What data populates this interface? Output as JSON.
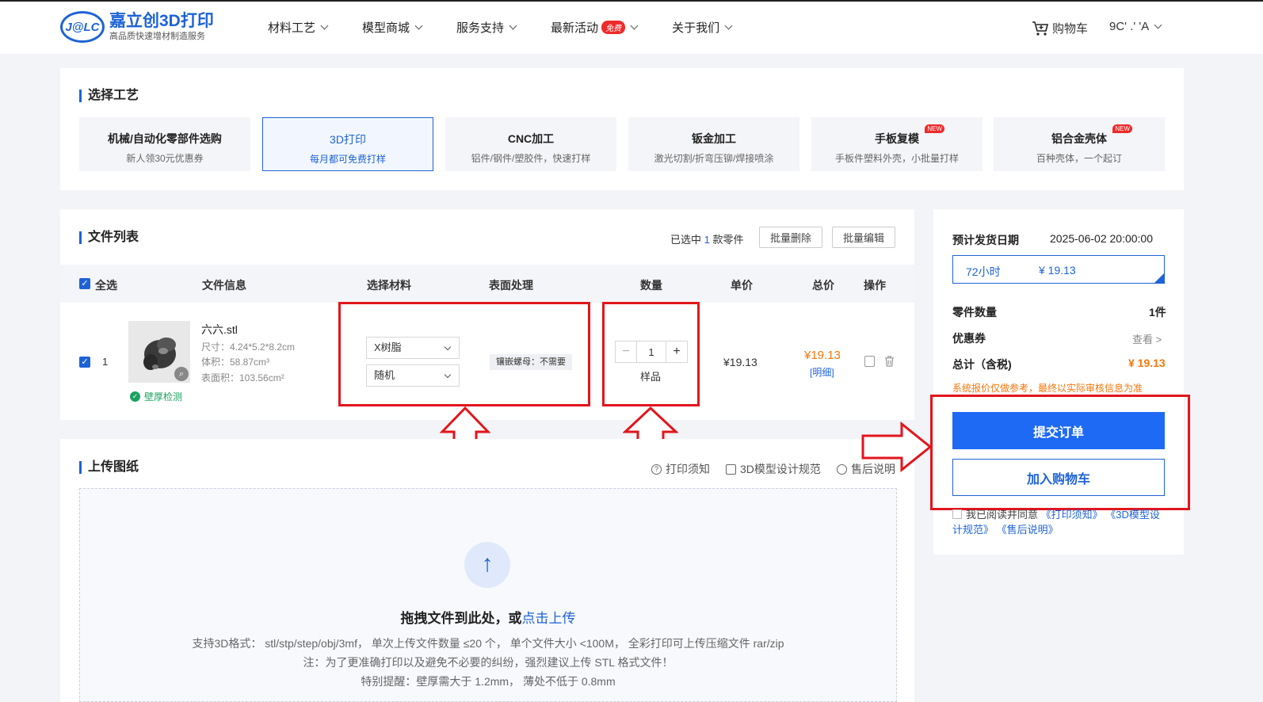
{
  "header": {
    "logo_mark": "J@LC",
    "logo_title": "嘉立创3D打印",
    "logo_sub": "高品质快速增材制造服务",
    "nav": [
      {
        "label": "材料工艺"
      },
      {
        "label": "模型商城"
      },
      {
        "label": "服务支持"
      },
      {
        "label": "最新活动",
        "badge": "免费"
      },
      {
        "label": "关于我们"
      }
    ],
    "cart_label": "购物车",
    "user_label": "9C' .' 'A"
  },
  "process": {
    "title": "选择工艺",
    "cards": [
      {
        "name": "机械/自动化零部件选购",
        "desc": "新人领30元优惠券"
      },
      {
        "name": "3D打印",
        "desc": "每月都可免费打样"
      },
      {
        "name": "CNC加工",
        "desc": "铝件/钢件/塑胶件，快速打样"
      },
      {
        "name": "钣金加工",
        "desc": "激光切割/折弯压铆/焊接喷涂"
      },
      {
        "name": "手板复模",
        "desc": "手板件塑料外壳，小批量打样",
        "badge": "NEW"
      },
      {
        "name": "铝合金壳体",
        "desc": "百种壳体，一个起订",
        "badge": "NEW"
      }
    ]
  },
  "file_list": {
    "title": "文件列表",
    "selected_prefix": "已选中",
    "selected_count": "1",
    "selected_suffix": "款零件",
    "batch_delete": "批量删除",
    "batch_edit": "批量编辑",
    "columns": {
      "select_all": "全选",
      "file_info": "文件信息",
      "material": "选择材料",
      "surface": "表面处理",
      "quantity": "数量",
      "unit_price": "单价",
      "total": "总价",
      "action": "操作"
    },
    "row": {
      "index": "1",
      "name": "六六.stl",
      "size": "尺寸：4.24*5.2*8.2cm",
      "volume": "体积：58.87cm³",
      "area": "表面积：103.56cm²",
      "wall_check": "壁厚检测",
      "material": "X树脂",
      "color": "随机",
      "surface": "镶嵌螺母：不需要",
      "quantity": "1",
      "quantity_note": "样品",
      "unit_price": "¥19.13",
      "total_price": "¥19.13",
      "detail": "[明细]"
    }
  },
  "upload": {
    "title": "上传图纸",
    "links": [
      "打印须知",
      "3D模型设计规范",
      "售后说明"
    ],
    "drop_main": "拖拽文件到此处，或",
    "drop_link": "点击上传",
    "line1": "支持3D格式：  stl/stp/step/obj/3mf，  单次上传文件数量 ≤20 个，  单个文件大小 <100M，  全彩打印可上传压缩文件 rar/zip",
    "line2": "注：为了更准确打印以及避免不必要的纠纷，强烈建议上传 STL 格式文件！",
    "line3": "特别提醒：壁厚需大于 1.2mm，  薄处不低于 0.8mm"
  },
  "summary": {
    "ship_label": "预计发货日期",
    "ship_date": "2025-06-02 20:00:00",
    "ship_option": "72小时",
    "ship_price": "¥ 19.13",
    "parts_label": "零件数量",
    "parts_value": "1件",
    "coupon_label": "优惠券",
    "coupon_value": "查看 >",
    "total_label": "总计（含税)",
    "total_value": "¥ 19.13",
    "warning": "系统报价仅做参考，最终以实际审核信息为准",
    "submit": "提交订单",
    "add_cart": "加入购物车",
    "agree_prefix": "我已阅读并同意",
    "agree_link1": "《打印须知》",
    "agree_link2": "《3D模型设计规范》",
    "agree_link3": "《售后说明》"
  },
  "colors": {
    "accent": "#1e63d6",
    "button_primary": "#1e6af5",
    "price_orange": "#f5760a",
    "annotation_red": "#e2151c"
  }
}
